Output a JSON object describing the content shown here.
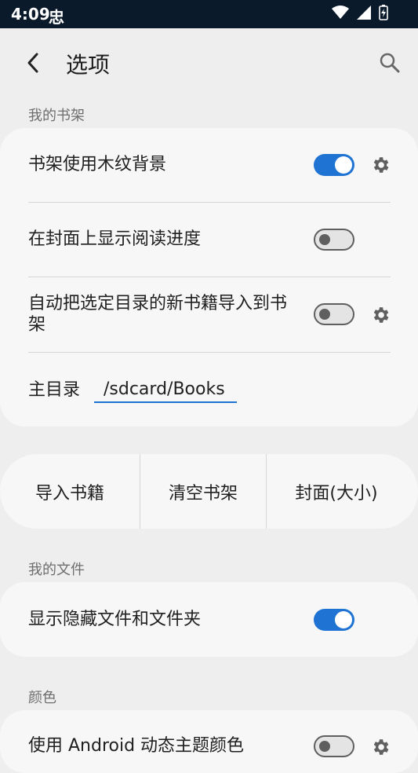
{
  "status": {
    "time": "4:09",
    "notif": "忠"
  },
  "header": {
    "title": "选项"
  },
  "bookshelf": {
    "section": "我的书架",
    "wood_bg": "书架使用木纹背景",
    "show_progress": "在封面上显示阅读进度",
    "auto_import": "自动把选定目录的新书籍导入到书架",
    "main_dir_label": "主目录",
    "main_dir_value": "/sdcard/Books",
    "toggles": {
      "wood_bg": true,
      "show_progress": false,
      "auto_import": false
    }
  },
  "actions": {
    "import": "导入书籍",
    "clear": "清空书架",
    "cover": "封面(大小)"
  },
  "files": {
    "section": "我的文件",
    "show_hidden": "显示隐藏文件和文件夹",
    "show_hidden_on": true
  },
  "colors": {
    "section": "颜色",
    "dynamic_theme": "使用 Android 动态主题颜色"
  },
  "palette": {
    "accent": "#1e73d3",
    "status_bar": "#0b1a2a",
    "background": "#eeeeee"
  }
}
